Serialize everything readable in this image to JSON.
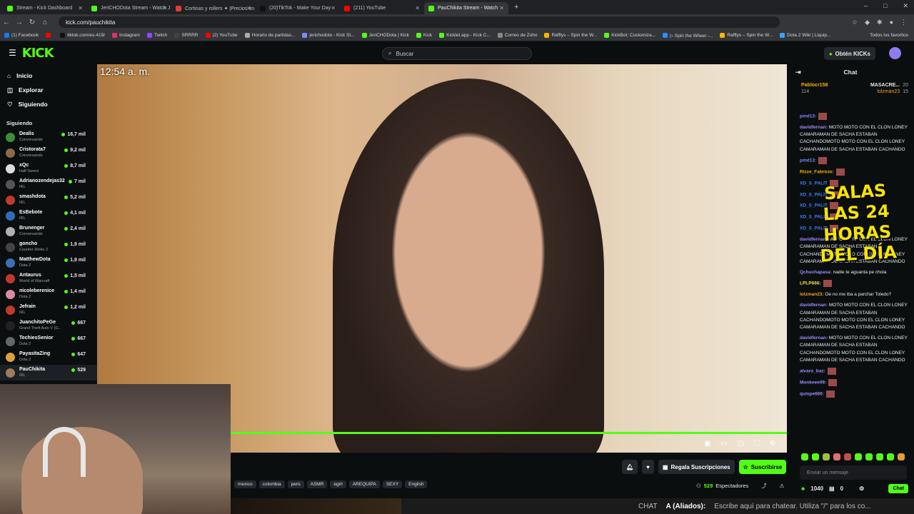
{
  "browser": {
    "tabs": [
      {
        "label": "Stream - Kick Dashboard",
        "color": "#53fc18",
        "active": false
      },
      {
        "label": "JeriCHODota Stream - Watch J",
        "color": "#53fc18",
        "active": false
      },
      {
        "label": "Cortinas y rollers ✦ |Precios en",
        "color": "#e53935",
        "active": false
      },
      {
        "label": "(20)TikTok - Make Your Day",
        "color": "#111111",
        "active": false
      },
      {
        "label": "(211) YouTube",
        "color": "#ff0000",
        "active": false
      },
      {
        "label": "PauChikita Stream - Watch",
        "color": "#53fc18",
        "active": true
      }
    ],
    "url": "kick.com/pauchikita",
    "bookmarks": [
      {
        "label": "(1) Facebook",
        "color": "#1877f2"
      },
      {
        "label": "",
        "color": "#ff0000"
      },
      {
        "label": "tiktok.com/es-419/",
        "color": "#111"
      },
      {
        "label": "Instagram",
        "color": "#e1306c"
      },
      {
        "label": "Twitch",
        "color": "#9146ff"
      },
      {
        "label": "SRRRR",
        "color": "#444"
      },
      {
        "label": "(2) YouTube",
        "color": "#ff0000"
      },
      {
        "label": "Horario de partidas...",
        "color": "#aaa"
      },
      {
        "label": "jerichodoto - Kick St...",
        "color": "#7b8cff"
      },
      {
        "label": "JeriCHODota | Kick",
        "color": "#53fc18"
      },
      {
        "label": "Kick",
        "color": "#53fc18"
      },
      {
        "label": "Kicklet.app - Kick C...",
        "color": "#53fc18"
      },
      {
        "label": "Correo de Zoho",
        "color": "#888"
      },
      {
        "label": "Rafflys – Spin the W...",
        "color": "#f7b500"
      },
      {
        "label": "KickBot: Customiza...",
        "color": "#53fc18"
      },
      {
        "label": "▷ Spin the Wheel -...",
        "color": "#2a8cff"
      },
      {
        "label": "Rafflys – Spin the W...",
        "color": "#f7b500"
      },
      {
        "label": "Dota 2 Wiki | Liquip...",
        "color": "#3aa0ff"
      }
    ],
    "all_favorites": "Todos los favoritos"
  },
  "kick": {
    "logo": "KICK",
    "search_placeholder": "Buscar",
    "get_kicks": "Obtén KICKs",
    "nav": [
      {
        "label": "Inicio",
        "icon": "home-icon",
        "glyph": "⌂"
      },
      {
        "label": "Explorar",
        "icon": "compass-icon",
        "glyph": "◫"
      },
      {
        "label": "Siguiendo",
        "icon": "heart-icon",
        "glyph": "♡"
      }
    ],
    "following_heading": "Siguiendo",
    "following": [
      {
        "name": "Dealis",
        "cat": "Conversando",
        "viewers": "16,7 mil",
        "color": "#3a8f3a"
      },
      {
        "name": "Cristorata7",
        "cat": "Conversando",
        "viewers": "9,2 mil",
        "color": "#8a6a4a"
      },
      {
        "name": "xQc",
        "cat": "Half Sword",
        "viewers": "8,7 mil",
        "color": "#dddddd"
      },
      {
        "name": "Adrianozendejas32",
        "cat": "IRL",
        "viewers": "7 mil",
        "color": "#555555"
      },
      {
        "name": "smashdota",
        "cat": "IRL",
        "viewers": "5,2 mil",
        "color": "#c0392b"
      },
      {
        "name": "EsBebote",
        "cat": "IRL",
        "viewers": "4,1 mil",
        "color": "#2c6fb7"
      },
      {
        "name": "Brunenger",
        "cat": "Conversando",
        "viewers": "2,4 mil",
        "color": "#b0b0b0"
      },
      {
        "name": "goncho",
        "cat": "Counter-Strike 2",
        "viewers": "1,9 mil",
        "color": "#444444"
      },
      {
        "name": "MatthewDota",
        "cat": "Dota 2",
        "viewers": "1,9 mil",
        "color": "#3a6fb7"
      },
      {
        "name": "Antaurus",
        "cat": "World of Warcraft",
        "viewers": "1,5 mil",
        "color": "#c0392b"
      },
      {
        "name": "nicoleberenice",
        "cat": "Dota 2",
        "viewers": "1,4 mil",
        "color": "#d98aa0"
      },
      {
        "name": "Jefrain",
        "cat": "IRL",
        "viewers": "1,2 mil",
        "color": "#c0392b"
      },
      {
        "name": "JuanchitoPeGe",
        "cat": "Grand Theft Auto V (G...",
        "viewers": "667",
        "color": "#222222"
      },
      {
        "name": "TechiesSenior",
        "cat": "Dota 2",
        "viewers": "667",
        "color": "#666666"
      },
      {
        "name": "PayasitaZing",
        "cat": "Dota 2",
        "viewers": "647",
        "color": "#d9a13b"
      },
      {
        "name": "PauChikita",
        "cat": "IRL",
        "viewers": "529",
        "color": "#a07a5a"
      }
    ],
    "video_overlay_time": "12:54 a. m.",
    "tags": [
      "mexico",
      "colombia",
      "perú",
      "ASMR",
      "egirl",
      "AREQUIPA",
      "SEXY",
      "English"
    ],
    "actions": {
      "gift": "Regala Suscripciones",
      "subscribe": "Suscribirse"
    },
    "viewers_count": "529",
    "viewers_label": "Espectadores",
    "ticker": {
      "chat": "CHAT",
      "allied": "A (Aliados):",
      "text": "Escribe aquí para chatear. Utiliza \"/\" para los co..."
    }
  },
  "chat": {
    "title": "Chat",
    "pinned": {
      "user1": "Pablocr158",
      "num1": "114",
      "user2": "MASACRE...",
      "num2": "20",
      "user3": "lolzman23",
      "num3": "15"
    },
    "messages": [
      {
        "user": "pmd13:",
        "text": "",
        "color": "#7b8cff"
      },
      {
        "user": "davidfernan:",
        "text": "MOTO MOTO CON EL CLON LONEY CAMARAMAN DE SACHA ESTABAN CACHANDOMOTO MOTO CON EL CLON LONEY CAMARAMAN DE SACHA ESTABAN CACHANDO",
        "color": "#9b8cff"
      },
      {
        "user": "pmd13:",
        "text": "",
        "color": "#7b8cff"
      },
      {
        "user": "Rizze_Fabricio:",
        "text": "",
        "color": "#f4b400"
      },
      {
        "user": "XD_S_PALIT",
        "text": "",
        "color": "#3b82f6"
      },
      {
        "user": "XD_S_PALIT",
        "text": "",
        "color": "#3b82f6"
      },
      {
        "user": "XD_S_PALIT",
        "text": "",
        "color": "#3b82f6"
      },
      {
        "user": "XD_S_PALIT",
        "text": "",
        "color": "#3b82f6"
      },
      {
        "user": "XD_S_PALIT",
        "text": "",
        "color": "#3b82f6"
      },
      {
        "user": "davidfernan:",
        "text": "MOTO MOTO CON EL CLON LONEY CAMARAMAN DE SACHA ESTABAN CACHANDOMOTO MOTO CON EL CLON LONEY CAMARAMAN DE SACHA ESTABAN CACHANDO",
        "color": "#9b8cff"
      },
      {
        "user": "Qchuchapasa:",
        "text": "nadie te aguanta pe chola",
        "color": "#9b8cff"
      },
      {
        "user": "LPLP666:",
        "text": "",
        "color": "#f4e04d"
      },
      {
        "user": "lolzman23:",
        "text": "Oe no me iba a parchar Toledo?",
        "color": "#f4a020"
      },
      {
        "user": "davidfernan:",
        "text": "MOTO MOTO CON EL CLON LONEY CAMARAMAN DE SACHA ESTABAN CACHANDOMOTO MOTO CON EL CLON LONEY CAMARAMAN DE SACHA ESTABAN CACHANDO",
        "color": "#9b8cff"
      },
      {
        "user": "davidfernan:",
        "text": "MOTO MOTO CON EL CLON LONEY CAMARAMAN DE SACHA ESTABAN CACHANDOMOTO MOTO CON EL CLON LONEY CAMARAMAN DE SACHA ESTABAN CACHANDO",
        "color": "#9b8cff"
      },
      {
        "user": "alvaro_baz:",
        "text": "",
        "color": "#9b8cff"
      },
      {
        "user": "Monkeee09:",
        "text": "",
        "color": "#9b8cff"
      },
      {
        "user": "quispe666:",
        "text": "",
        "color": "#9b8cff"
      }
    ],
    "overlay_text": "SALAS LAS 24 HORAS DEL DÍA",
    "input_placeholder": "Enviar un mensaje",
    "kicks": "1040",
    "subs": "0",
    "send": "Chat"
  }
}
